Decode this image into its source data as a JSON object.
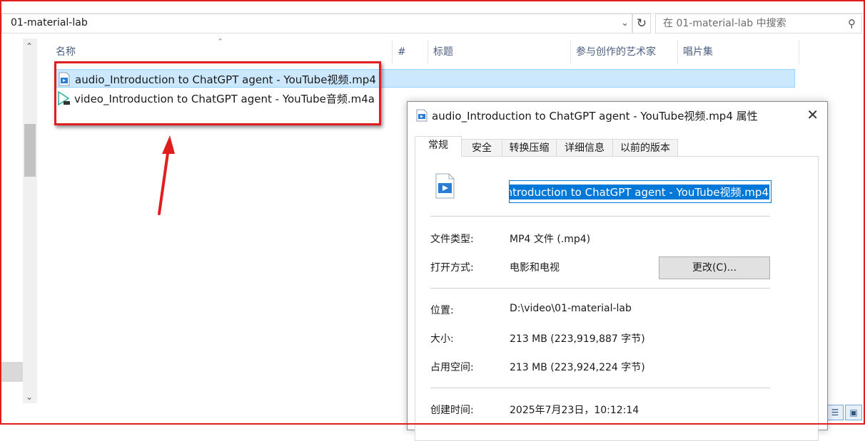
{
  "explorer": {
    "path": "01-material-lab",
    "search_placeholder": "在 01-material-lab 中搜索",
    "columns": [
      "名称",
      "#",
      "标题",
      "参与创作的艺术家",
      "唱片集"
    ],
    "files": [
      {
        "name": "audio_Introduction to ChatGPT agent - YouTube视频.mp4",
        "icon": "video-file-icon",
        "selected": true
      },
      {
        "name": "video_Introduction to ChatGPT agent - YouTube音频.m4a",
        "icon": "audio-file-icon",
        "selected": false
      }
    ]
  },
  "dialog": {
    "title": "audio_Introduction to ChatGPT agent - YouTube视频.mp4 属性",
    "tabs": [
      "常规",
      "安全",
      "转换压缩",
      "详细信息",
      "以前的版本"
    ],
    "active_tab": "常规",
    "filename_field": "ntroduction to ChatGPT agent - YouTube视频.mp4",
    "props": {
      "type_label": "文件类型:",
      "type_value": "MP4 文件 (.mp4)",
      "open_label": "打开方式:",
      "open_value": "电影和电视",
      "change_button": "更改(C)...",
      "location_label": "位置:",
      "location_value": "D:\\video\\01-material-lab",
      "size_label": "大小:",
      "size_value": "213 MB (223,919,887 字节)",
      "disk_label": "占用空间:",
      "disk_value": "213 MB (223,924,224 字节)",
      "created_label": "创建时间:",
      "created_value": "2025年7月23日，10:12:14"
    }
  },
  "colors": {
    "annotation_red": "#e01e1e",
    "selection_bg": "#cce8ff",
    "accent": "#0078d7"
  }
}
